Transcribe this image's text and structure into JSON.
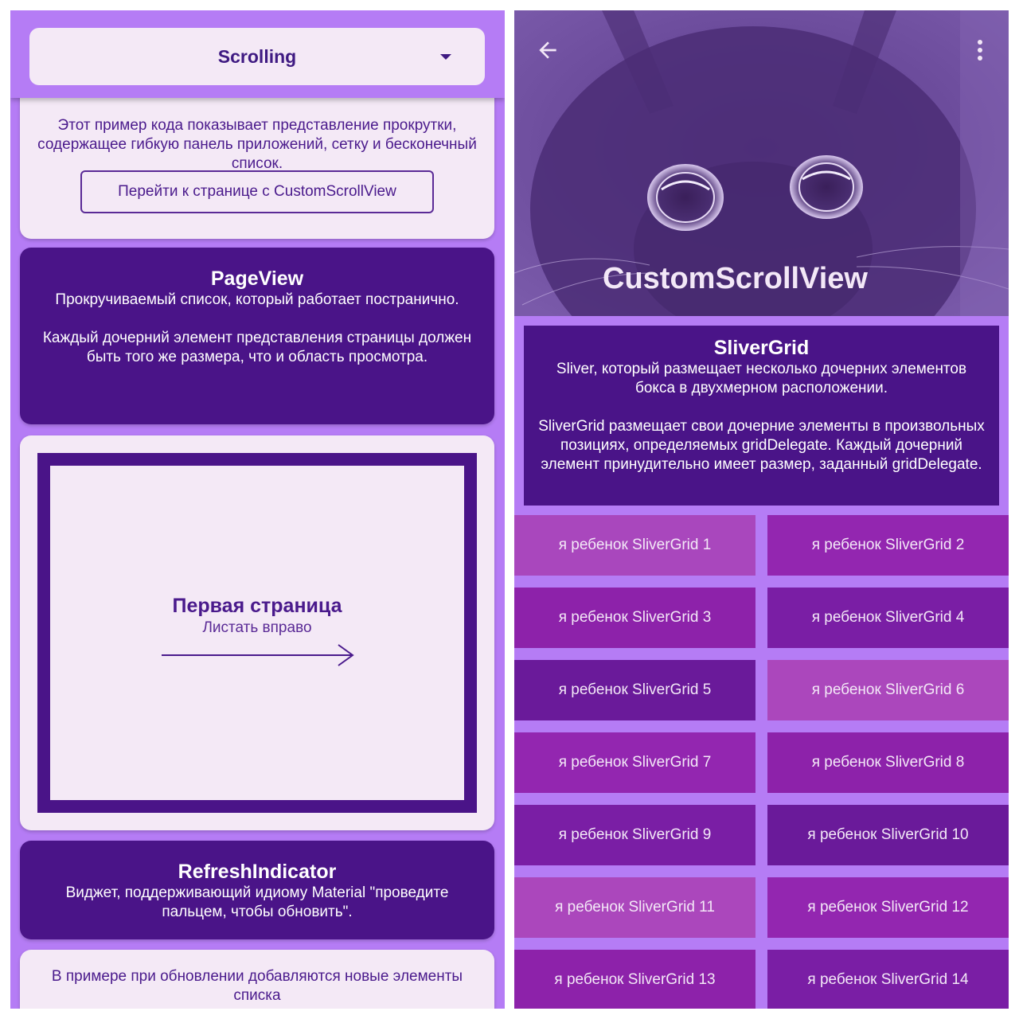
{
  "left": {
    "dropdown": {
      "label": "Scrolling"
    },
    "intro": {
      "text": "Этот пример кода показывает представление прокрутки, содержащее гибкую панель приложений, сетку и бесконечный список.",
      "button": "Перейти к странице с CustomScrollView"
    },
    "pageview": {
      "title": "PageView",
      "desc": "Прокручиваемый список, который работает постранично.\n\nКаждый дочерний элемент представления страницы должен быть того же размера, что и область просмотра."
    },
    "page": {
      "title": "Первая страница",
      "subtitle": "Листать вправо"
    },
    "refresh": {
      "title": "RefreshIndicator",
      "desc": "Виджет, поддерживающий идиому Material \"проведите пальцем, чтобы обновить\"."
    },
    "example": {
      "text": "В примере при обновлении добавляются новые элементы списка"
    }
  },
  "right": {
    "header_title": "CustomScrollView",
    "sliver": {
      "title": "SliverGrid",
      "desc": "Sliver, который размещает несколько дочерних элементов бокса в двухмерном расположении.\n\nSliverGrid размещает свои дочерние элементы в произвольных позициях, определяемых gridDelegate. Каждый дочерний элемент принудительно имеет размер, заданный gridDelegate."
    },
    "grid": [
      {
        "label": "я ребенок SliverGrid 1",
        "color": "#a947bd"
      },
      {
        "label": "я ребенок SliverGrid 2",
        "color": "#9326b0"
      },
      {
        "label": "я ребенок SliverGrid 3",
        "color": "#8d22aa"
      },
      {
        "label": "я ребенок SliverGrid 4",
        "color": "#7a1ea5"
      },
      {
        "label": "я ребенок SliverGrid 5",
        "color": "#6a1a9a"
      },
      {
        "label": "я ребенок SliverGrid 6",
        "color": "#ab47bc"
      },
      {
        "label": "я ребенок SliverGrid 7",
        "color": "#9326b0"
      },
      {
        "label": "я ребенок SliverGrid 8",
        "color": "#8d22aa"
      },
      {
        "label": "я ребенок SliverGrid 9",
        "color": "#7a1ea5"
      },
      {
        "label": "я ребенок SliverGrid 10",
        "color": "#6a1a9a"
      },
      {
        "label": "я ребенок SliverGrid 11",
        "color": "#ab47bc"
      },
      {
        "label": "я ребенок SliverGrid 12",
        "color": "#9326b0"
      },
      {
        "label": "я ребенок SliverGrid 13",
        "color": "#8d22aa"
      },
      {
        "label": "я ребенок SliverGrid 14",
        "color": "#7a1ea5"
      }
    ]
  },
  "colors": {
    "primary": "#4a1488",
    "accent": "#b57cf5",
    "surface": "#f4e9f6"
  },
  "icons": [
    "chevron-down-icon",
    "back-arrow-icon",
    "more-vert-icon",
    "arrow-right-icon"
  ]
}
